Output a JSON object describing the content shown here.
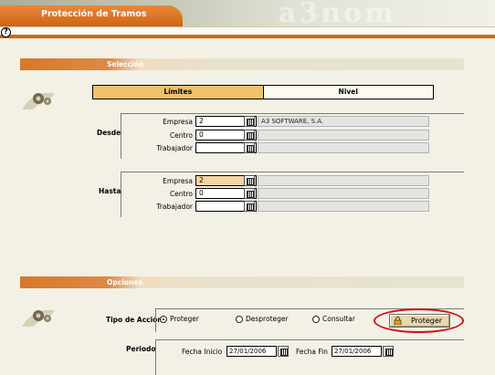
{
  "window": {
    "title": "Protección de Tramos",
    "watermark_text": "a3nom",
    "help_icon": "question-mark-icon"
  },
  "sections": {
    "selection": "Selección",
    "options": "Opciones"
  },
  "tabs": [
    {
      "label": "Límites",
      "active": true
    },
    {
      "label": "Nivel",
      "active": false
    }
  ],
  "desde": {
    "label": "Desde",
    "rows": [
      {
        "label": "Empresa",
        "value": "2",
        "description": "A3 SOFTWARE, S.A."
      },
      {
        "label": "Centro",
        "value": "0",
        "description": ""
      },
      {
        "label": "Trabajador",
        "value": "",
        "description": ""
      }
    ]
  },
  "hasta": {
    "label": "Hasta",
    "rows": [
      {
        "label": "Empresa",
        "value": "2",
        "description": ""
      },
      {
        "label": "Centro",
        "value": "0",
        "description": ""
      },
      {
        "label": "Trabajador",
        "value": "",
        "description": ""
      }
    ]
  },
  "options": {
    "tipo_label": "Tipo de Acción",
    "radios": [
      {
        "label": "Proteger",
        "selected": true
      },
      {
        "label": "Desproteger",
        "selected": false
      },
      {
        "label": "Consultar",
        "selected": false
      }
    ],
    "action_button": "Proteger",
    "periodo_label": "Periodo",
    "fecha_inicio_label": "Fecha Inicio",
    "fecha_inicio": "27/01/2006",
    "fecha_fin_label": "Fecha Fin",
    "fecha_fin": "27/01/2006"
  },
  "colors": {
    "accent": "#d87826",
    "tab_active": "#f0c26c",
    "highlight_ring": "#d01010"
  }
}
